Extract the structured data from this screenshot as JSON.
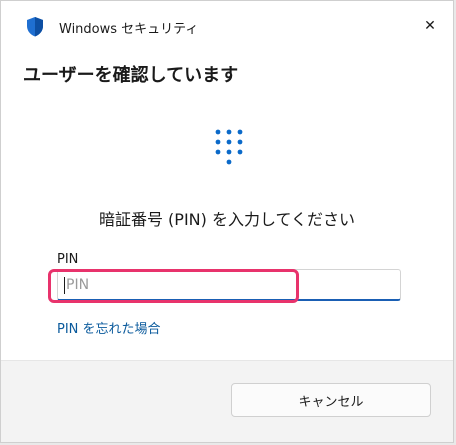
{
  "window": {
    "title": "Windows セキュリティ",
    "close_glyph": "✕"
  },
  "dialog": {
    "heading": "ユーザーを確認しています",
    "prompt": "暗証番号 (PIN) を入力してください",
    "pin_label": "PIN",
    "pin_placeholder": "PIN",
    "pin_value": "",
    "forgot_link": "PIN を忘れた場合",
    "cancel_label": "キャンセル"
  },
  "icons": {
    "title_icon": "shield-icon",
    "keypad": "pin-keypad-icon",
    "close": "close-icon"
  },
  "colors": {
    "accent": "#1a5fb4",
    "link": "#0a5a9c",
    "keypad_blue": "#0b6ac9",
    "highlight": "#e8336c"
  }
}
